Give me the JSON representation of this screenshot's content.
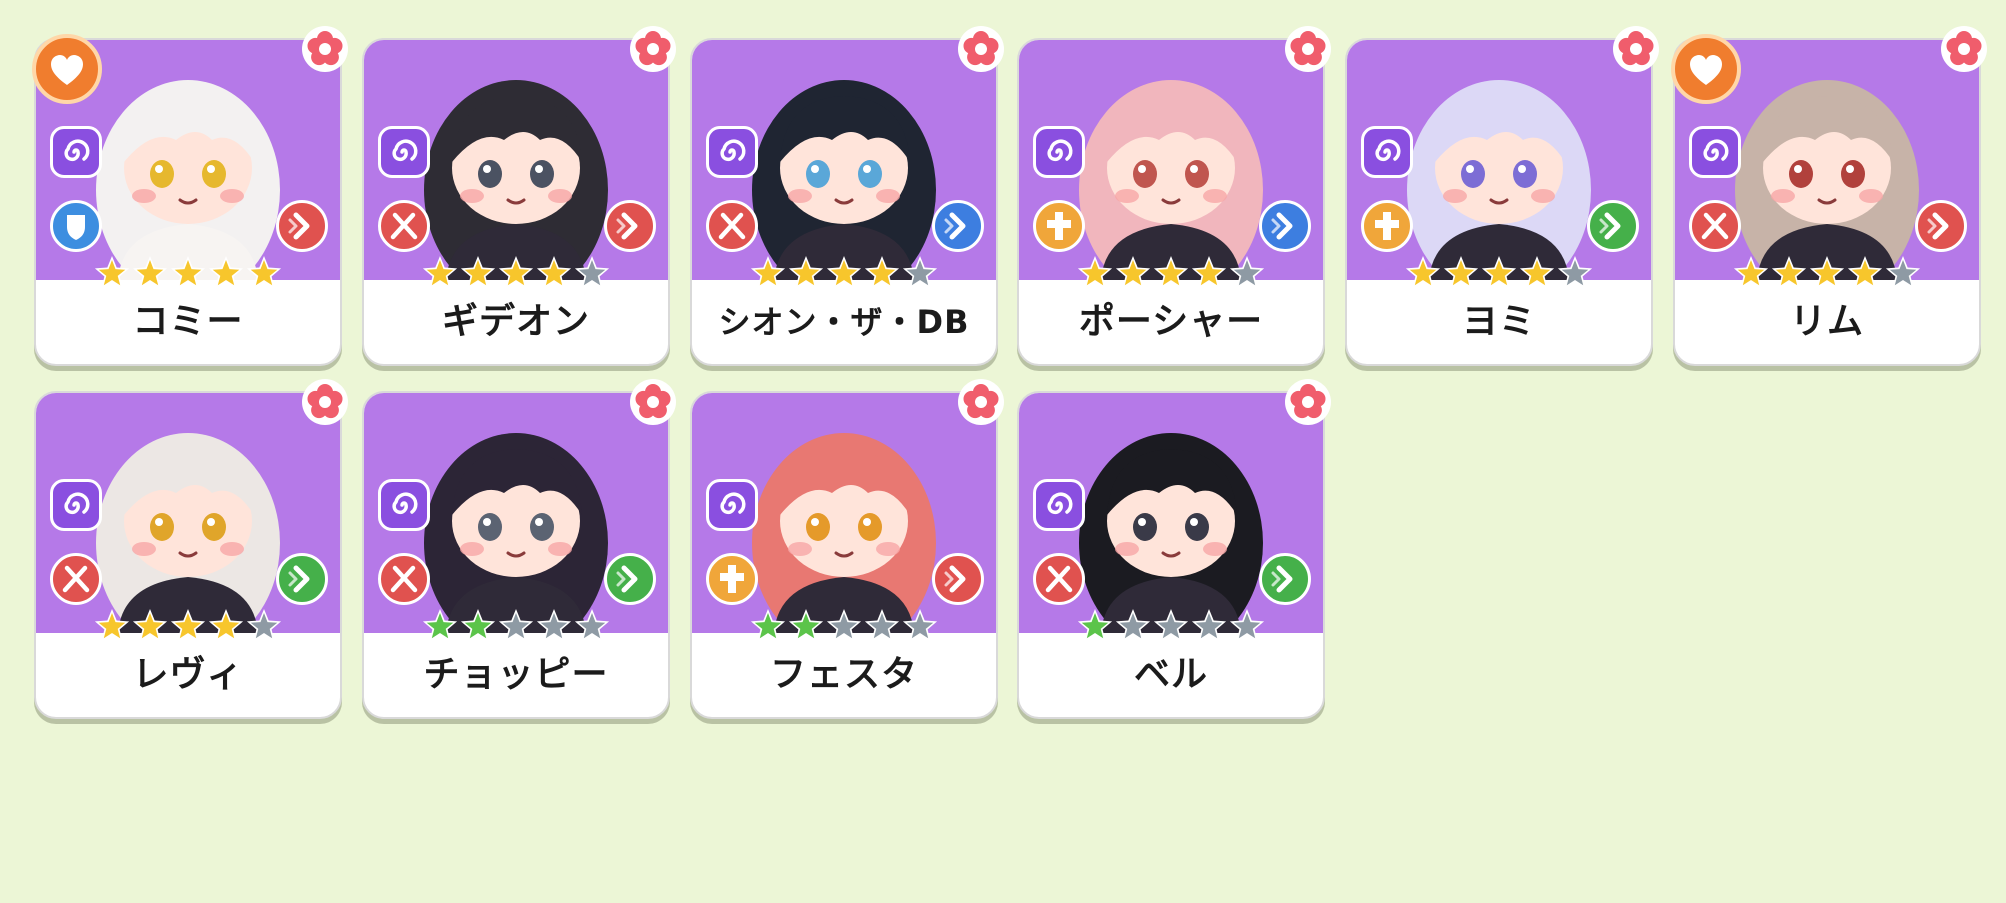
{
  "colors": {
    "background": "#ecf6d6",
    "portrait": "#b579e8",
    "star_gold": "#f7c62c",
    "star_green": "#5bc44a",
    "star_empty": "#8e9aa4",
    "role_red": "#e0524f",
    "role_blue": "#3d8ee0",
    "role_orange": "#f0a63a",
    "attack_red": "#e0524f",
    "attack_blue": "#3d7ee0",
    "attack_green": "#45b04a",
    "element_purple": "#8a4fe0"
  },
  "characters": [
    {
      "name": "コミー",
      "stars_filled": 5,
      "star_color": "gold",
      "role": "shield-icon",
      "role_color": "blue",
      "attack_color": "red",
      "favorite": true,
      "hair": "#f3f1f1",
      "skin": "#ffe4da",
      "eye": "#e6b82e"
    },
    {
      "name": "ギデオン",
      "stars_filled": 4,
      "star_color": "gold",
      "role": "sword-icon",
      "role_color": "red",
      "attack_color": "red",
      "favorite": false,
      "hair": "#2e2c34",
      "skin": "#ffe4da",
      "eye": "#4b5262"
    },
    {
      "name": "シオン・ザ・DB",
      "stars_filled": 4,
      "star_color": "gold",
      "role": "sword-icon",
      "role_color": "red",
      "attack_color": "blue",
      "favorite": false,
      "hair": "#1f2532",
      "skin": "#ffe4da",
      "eye": "#5aa7d8"
    },
    {
      "name": "ポーシャー",
      "stars_filled": 4,
      "star_color": "gold",
      "role": "cross-icon",
      "role_color": "orange",
      "attack_color": "blue",
      "favorite": false,
      "hair": "#f1b6bd",
      "skin": "#ffe4da",
      "eye": "#c0564f"
    },
    {
      "name": "ヨミ",
      "stars_filled": 4,
      "star_color": "gold",
      "role": "cross-icon",
      "role_color": "orange",
      "attack_color": "green",
      "favorite": false,
      "hair": "#dcd8f6",
      "skin": "#ffe4da",
      "eye": "#7d6dd5"
    },
    {
      "name": "リム",
      "stars_filled": 4,
      "star_color": "gold",
      "role": "sword-icon",
      "role_color": "red",
      "attack_color": "red",
      "favorite": true,
      "hair": "#c7b3a8",
      "skin": "#ffe4da",
      "eye": "#b1413c"
    },
    {
      "name": "レヴィ",
      "stars_filled": 4,
      "star_color": "gold",
      "role": "sword-icon",
      "role_color": "red",
      "attack_color": "green",
      "favorite": false,
      "hair": "#ece7e4",
      "skin": "#ffe4da",
      "eye": "#e0a52a"
    },
    {
      "name": "チョッピー",
      "stars_filled": 2,
      "star_color": "green",
      "role": "sword-icon",
      "role_color": "red",
      "attack_color": "green",
      "favorite": false,
      "hair": "#2c2536",
      "skin": "#ffe4da",
      "eye": "#5b6372"
    },
    {
      "name": "フェスタ",
      "stars_filled": 2,
      "star_color": "green",
      "role": "cross-icon",
      "role_color": "orange",
      "attack_color": "red",
      "favorite": false,
      "hair": "#e87872",
      "skin": "#ffe4da",
      "eye": "#e59a2a"
    },
    {
      "name": "ベル",
      "stars_filled": 1,
      "star_color": "green",
      "role": "sword-icon",
      "role_color": "red",
      "attack_color": "green",
      "favorite": false,
      "hair": "#1b1b21",
      "skin": "#ffe4da",
      "eye": "#3a3a48"
    }
  ],
  "stars_total": 5
}
